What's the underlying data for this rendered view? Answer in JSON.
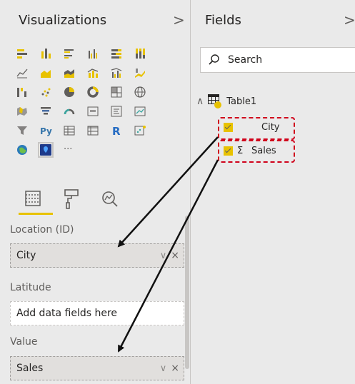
{
  "viz_panel": {
    "title": "Visualizations",
    "collapse_glyph": ">"
  },
  "fields_panel": {
    "title": "Fields",
    "collapse_glyph": ">"
  },
  "viz_icons": [
    "stacked-bar-chart-icon",
    "stacked-column-chart-icon",
    "clustered-bar-chart-icon",
    "clustered-column-chart-icon",
    "100-stacked-bar-chart-icon",
    "100-stacked-column-chart-icon",
    "line-chart-icon",
    "area-chart-icon",
    "stacked-area-chart-icon",
    "line-and-stacked-column-chart-icon",
    "line-and-clustered-column-chart-icon",
    "ribbon-chart-icon",
    "waterfall-chart-icon",
    "scatter-chart-icon",
    "pie-chart-icon",
    "donut-chart-icon",
    "treemap-icon",
    "map-icon",
    "filled-map-icon",
    "funnel-icon",
    "gauge-icon",
    "card-icon",
    "multi-row-card-icon",
    "kpi-icon",
    "slicer-icon",
    "python-visual-icon",
    "table-icon",
    "matrix-icon",
    "r-visual-icon",
    "key-influencers-icon",
    "arcgis-map-icon",
    "azure-map-icon",
    "more-visuals-icon"
  ],
  "viz_icon_text": {
    "python": "Py",
    "r": "R",
    "more": "···"
  },
  "tabs": [
    "fields-tab-icon",
    "format-tab-icon",
    "analytics-tab-icon"
  ],
  "wells": {
    "location": {
      "label": "Location (ID)",
      "value": "City"
    },
    "latitude": {
      "label": "Latitude",
      "placeholder": "Add data fields here"
    },
    "value": {
      "label": "Value",
      "value": "Sales"
    },
    "remove_glyph": "×",
    "expand_glyph": "∨"
  },
  "search": {
    "placeholder": "Search"
  },
  "table": {
    "name": "Table1",
    "expand_glyph": "∧",
    "fields": [
      {
        "name": "City",
        "checked": true,
        "sigma": ""
      },
      {
        "name": "Sales",
        "checked": true,
        "sigma": "Σ"
      }
    ]
  },
  "colors": {
    "accent": "#e8c200",
    "highlight": "#d0021b",
    "panel_bg": "#eaeaea",
    "arrow": "#111111"
  }
}
